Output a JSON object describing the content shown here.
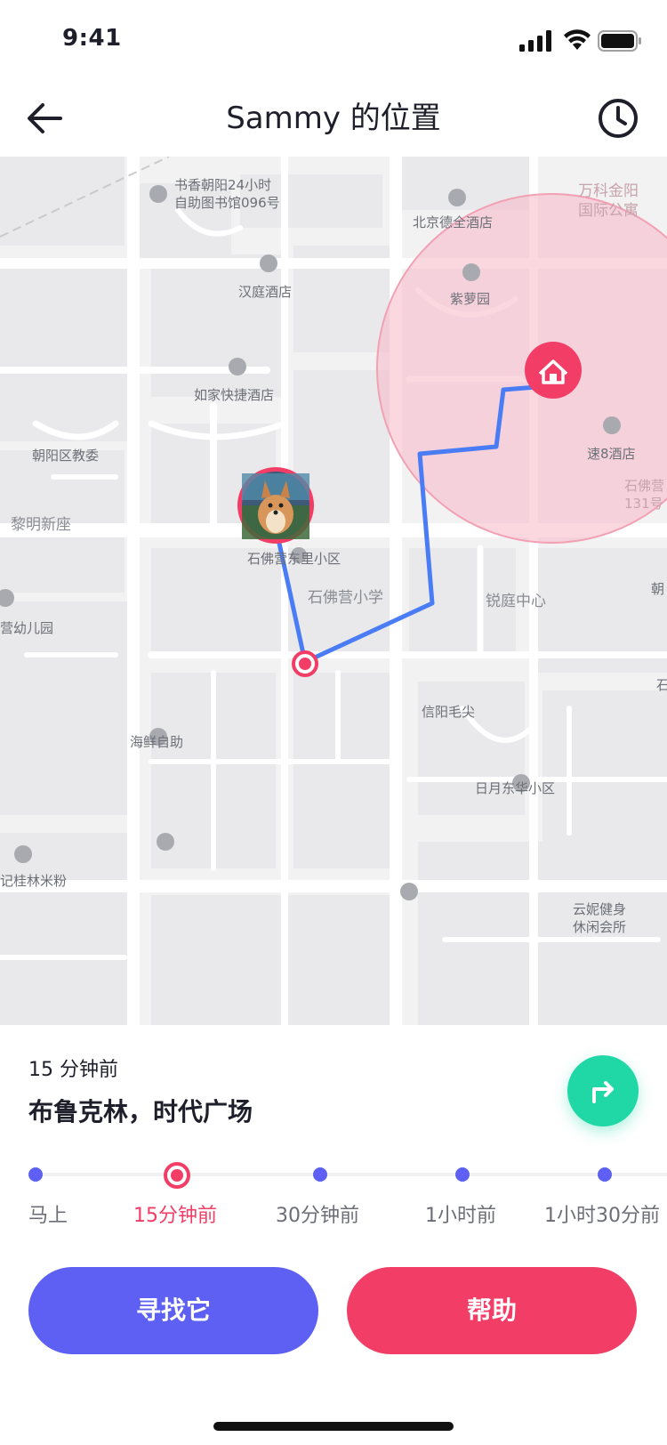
{
  "status_bar": {
    "time": "9:41"
  },
  "header": {
    "title": "Sammy 的位置"
  },
  "map": {
    "pois": [
      {
        "name": "书香朝阳24小时\n自助图书馆096号"
      },
      {
        "name": "北京德全酒店"
      },
      {
        "name": "万科金阳\n国际公寓"
      },
      {
        "name": "汉庭酒店"
      },
      {
        "name": "紫萝园"
      },
      {
        "name": "如家快捷酒店"
      },
      {
        "name": "朝阳区教委"
      },
      {
        "name": "速8酒店"
      },
      {
        "name": "石佛营\n131号"
      },
      {
        "name": "黎明新座"
      },
      {
        "name": "石佛营东里小区"
      },
      {
        "name": "石佛营小学"
      },
      {
        "name": "锐庭中心"
      },
      {
        "name": "朝"
      },
      {
        "name": "营幼儿园"
      },
      {
        "name": "石"
      },
      {
        "name": "信阳毛尖"
      },
      {
        "name": "海鲜自助"
      },
      {
        "name": "日月东华小区"
      },
      {
        "name": "记桂林米粉"
      },
      {
        "name": "云妮健身\n休闲会所"
      }
    ],
    "pet_marker": {
      "name": "Sammy"
    },
    "home_marker": {
      "icon": "home-icon"
    },
    "route_color": "#4a7cf5",
    "zone_color": "#f7b8c6"
  },
  "location": {
    "time_ago": "15 分钟前",
    "address": "布鲁克林，时代广场"
  },
  "timeline": [
    {
      "label": "马上",
      "active": false
    },
    {
      "label": "15分钟前",
      "active": true
    },
    {
      "label": "30分钟前",
      "active": false
    },
    {
      "label": "1小时前",
      "active": false
    },
    {
      "label": "1小时30分前",
      "active": false
    }
  ],
  "actions": {
    "find": "寻找它",
    "help": "帮助"
  },
  "colors": {
    "primary": "#5d60f2",
    "accent": "#f23e66",
    "direction": "#1fd8a6"
  }
}
